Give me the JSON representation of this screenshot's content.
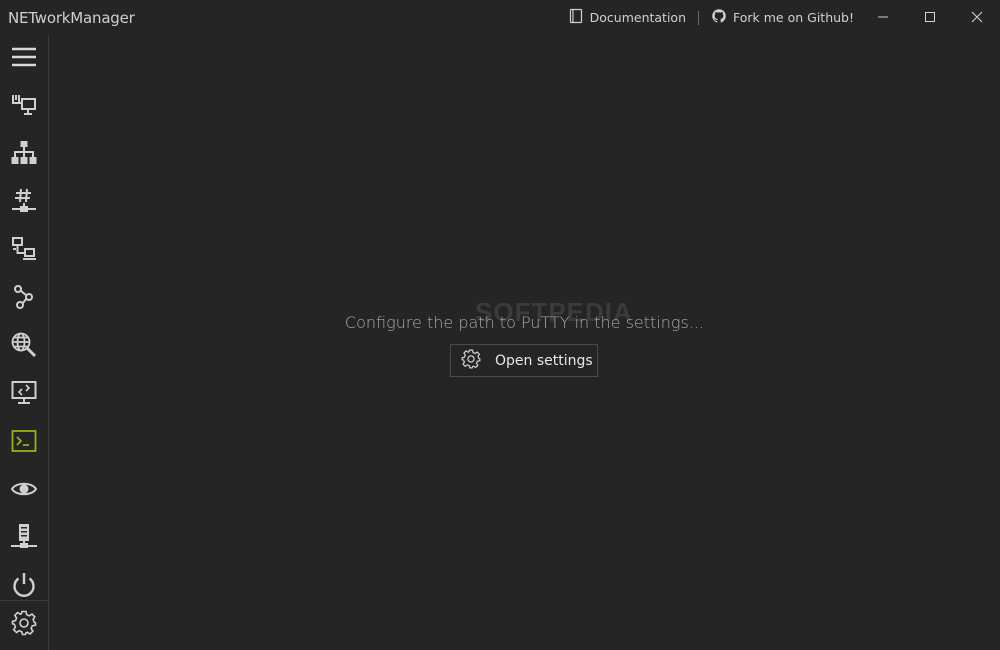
{
  "app": {
    "title": "NETworkManager"
  },
  "titlebar": {
    "documentation_label": "Documentation",
    "github_label": "Fork me on Github!",
    "icons": [
      "book-icon",
      "github-icon",
      "minimize-icon",
      "maximize-icon",
      "close-icon"
    ]
  },
  "sidebar": {
    "active_item": "putty",
    "active_color": "#8fb31a",
    "items": [
      "menu",
      "network-interface",
      "ip-scanner",
      "subnet-calculator",
      "port-scanner",
      "traceroute",
      "dns-lookup",
      "remote-desktop",
      "putty",
      "ping-monitor",
      "server",
      "wake-on-lan",
      "settings"
    ]
  },
  "main": {
    "message": "Configure the path to PuTTY in the settings...",
    "open_settings_label": "Open settings",
    "watermark": "SOFTPEDIA"
  }
}
